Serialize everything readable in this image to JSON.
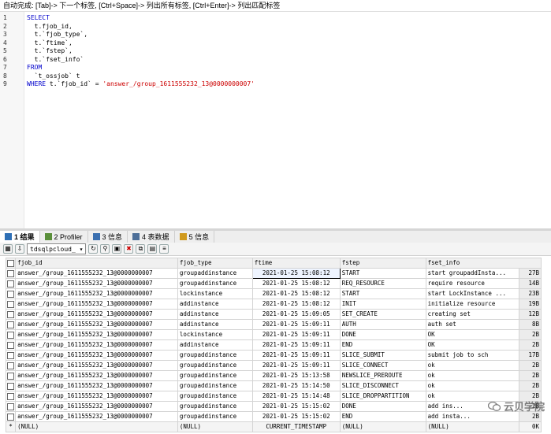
{
  "hint": "自动完成: [Tab]-> 下一个标签, [Ctrl+Space]-> 列出所有标签, [Ctrl+Enter]-> 列出匹配标签",
  "editor": {
    "lines": [
      {
        "num": "1",
        "indent": "",
        "kw": "SELECT",
        "text": "",
        "str": ""
      },
      {
        "num": "2",
        "indent": "  ",
        "kw": "",
        "text": "t.fjob_id,",
        "str": ""
      },
      {
        "num": "3",
        "indent": "  ",
        "kw": "",
        "text": "t.`fjob_type`,",
        "str": ""
      },
      {
        "num": "4",
        "indent": "  ",
        "kw": "",
        "text": "t.`ftime`,",
        "str": ""
      },
      {
        "num": "5",
        "indent": "  ",
        "kw": "",
        "text": "t.`fstep`,",
        "str": ""
      },
      {
        "num": "6",
        "indent": "  ",
        "kw": "",
        "text": "t.`fset_info`",
        "str": ""
      },
      {
        "num": "7",
        "indent": "",
        "kw": "FROM",
        "text": "",
        "str": ""
      },
      {
        "num": "8",
        "indent": "  ",
        "kw": "",
        "text": "`t_ossjob` t",
        "str": ""
      },
      {
        "num": "9",
        "indent": "",
        "kw": "WHERE",
        "text": " t.`fjob_id` = ",
        "str": "'answer_/group_1611555232_13@0000000007'"
      }
    ]
  },
  "tabs": [
    {
      "label": "1 结果",
      "icon": "table-icon",
      "active": true
    },
    {
      "label": "2 Profiler",
      "icon": "profiler-icon",
      "active": false
    },
    {
      "label": "3 信息",
      "icon": "info-icon",
      "active": false
    },
    {
      "label": "4 表数据",
      "icon": "table-data-icon",
      "active": false
    },
    {
      "label": "5 信息",
      "icon": "info2-icon",
      "active": false
    }
  ],
  "toolbar": {
    "database": "tdsqlpcloud_"
  },
  "grid": {
    "columns": [
      "fjob_id",
      "fjob_type",
      "ftime",
      "fstep",
      "fset_info"
    ],
    "rows": [
      [
        "answer_/group_1611555232_13@0000000007",
        "groupaddinstance",
        "2021-01-25 15:08:12",
        "START",
        "start groupaddInsta...",
        "27B"
      ],
      [
        "answer_/group_1611555232_13@0000000007",
        "groupaddinstance",
        "2021-01-25 15:08:12",
        "REQ_RESOURCE",
        "require resource",
        "14B"
      ],
      [
        "answer_/group_1611555232_13@0000000007",
        "lockinstance",
        "2021-01-25 15:08:12",
        "START",
        "start LockInstance ...",
        "23B"
      ],
      [
        "answer_/group_1611555232_13@0000000007",
        "addinstance",
        "2021-01-25 15:08:12",
        "INIT",
        "initialize resource",
        "19B"
      ],
      [
        "answer_/group_1611555232_13@0000000007",
        "addinstance",
        "2021-01-25 15:09:05",
        "SET_CREATE",
        "creating set",
        "12B"
      ],
      [
        "answer_/group_1611555232_13@0000000007",
        "addinstance",
        "2021-01-25 15:09:11",
        "AUTH",
        "auth set",
        "8B"
      ],
      [
        "answer_/group_1611555232_13@0000000007",
        "lockinstance",
        "2021-01-25 15:09:11",
        "DONE",
        "OK",
        "2B"
      ],
      [
        "answer_/group_1611555232_13@0000000007",
        "addinstance",
        "2021-01-25 15:09:11",
        "END",
        "OK",
        "2B"
      ],
      [
        "answer_/group_1611555232_13@0000000007",
        "groupaddinstance",
        "2021-01-25 15:09:11",
        "SLICE_SUBMIT",
        "submit job to sch",
        "17B"
      ],
      [
        "answer_/group_1611555232_13@0000000007",
        "groupaddinstance",
        "2021-01-25 15:09:11",
        "SLICE_CONNECT",
        "ok",
        "2B"
      ],
      [
        "answer_/group_1611555232_13@0000000007",
        "groupaddinstance",
        "2021-01-25 15:13:58",
        "NEWSLICE_PREROUTE",
        "ok",
        "2B"
      ],
      [
        "answer_/group_1611555232_13@0000000007",
        "groupaddinstance",
        "2021-01-25 15:14:50",
        "SLICE_DISCONNECT",
        "ok",
        "2B"
      ],
      [
        "answer_/group_1611555232_13@0000000007",
        "groupaddinstance",
        "2021-01-25 15:14:48",
        "SLICE_DROPPARTITION",
        "ok",
        "2B"
      ],
      [
        "answer_/group_1611555232_13@0000000007",
        "groupaddinstance",
        "2021-01-25 15:15:02",
        "DONE",
        "add ins...",
        "2B"
      ],
      [
        "answer_/group_1611555232_13@0000000007",
        "groupaddinstance",
        "2021-01-25 15:15:02",
        "END",
        "add insta...",
        "2B"
      ]
    ],
    "null_row": [
      "(NULL)",
      "(NULL)",
      "CURRENT_TIMESTAMP",
      "(NULL)",
      "(NULL)",
      "0K"
    ],
    "new_row_marker": "*"
  },
  "watermark": {
    "text": "云贝学院",
    "icon": "wechat-icon"
  }
}
